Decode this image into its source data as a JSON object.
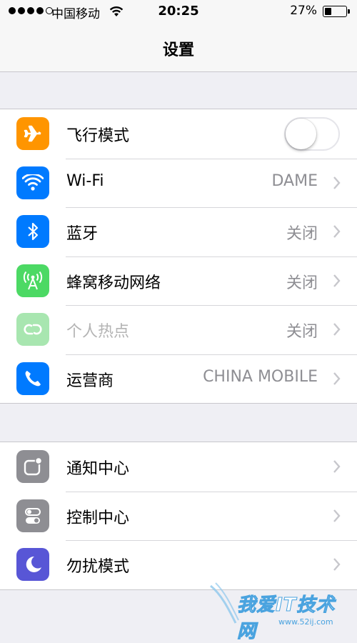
{
  "status_bar": {
    "carrier": "中国移动",
    "time": "20:25",
    "battery_percent": "27%",
    "battery_level": 0.27,
    "signal_bars_filled": 4,
    "signal_bars_total": 5
  },
  "nav": {
    "title": "设置"
  },
  "group1": [
    {
      "id": "airplane",
      "label": "飞行模式",
      "icon": "airplane-icon",
      "icon_color": "#ff9500",
      "toggle": false
    },
    {
      "id": "wifi",
      "label": "Wi-Fi",
      "value": "DAME",
      "icon": "wifi-icon",
      "icon_color": "#007aff"
    },
    {
      "id": "bluetooth",
      "label": "蓝牙",
      "value": "关闭",
      "icon": "bluetooth-icon",
      "icon_color": "#007aff"
    },
    {
      "id": "cellular",
      "label": "蜂窝移动网络",
      "value": "关闭",
      "icon": "cellular-antenna-icon",
      "icon_color": "#4cd964"
    },
    {
      "id": "hotspot",
      "label": "个人热点",
      "value": "关闭",
      "icon": "hotspot-link-icon",
      "icon_color": "#a8e6b0",
      "disabled": true
    },
    {
      "id": "carrier",
      "label": "运营商",
      "value": "CHINA MOBILE",
      "icon": "phone-icon",
      "icon_color": "#007aff"
    }
  ],
  "group2": [
    {
      "id": "notification-center",
      "label": "通知中心",
      "icon": "notification-center-icon",
      "icon_color": "#8e8e93"
    },
    {
      "id": "control-center",
      "label": "控制中心",
      "icon": "control-center-icon",
      "icon_color": "#8e8e93"
    },
    {
      "id": "do-not-disturb",
      "label": "勿扰模式",
      "icon": "moon-icon",
      "icon_color": "#5856d6"
    }
  ],
  "watermark": {
    "text": "我爱IT技术网",
    "url": "www.52ij.com"
  },
  "colors": {
    "accent": "#007aff",
    "background": "#efeff4",
    "chevron": "#c7c7cc",
    "value_text": "#8e8e93"
  }
}
